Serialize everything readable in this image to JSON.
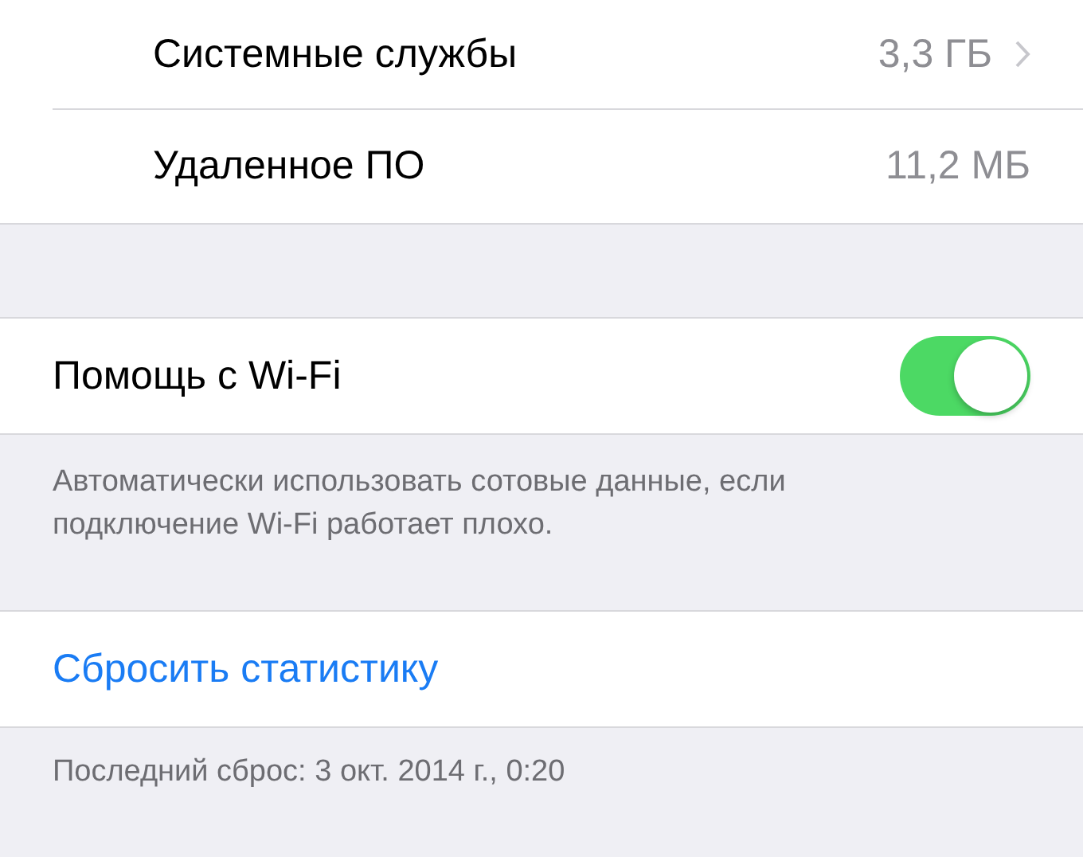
{
  "storage_rows": [
    {
      "label": "Системные службы",
      "value": "3,3 ГБ",
      "chevron": true
    },
    {
      "label": "Удаленное ПО",
      "value": "11,2 МБ",
      "chevron": false
    }
  ],
  "wifi_assist": {
    "label": "Помощь с Wi-Fi",
    "on": true,
    "footer": "Автоматически использовать сотовые данные, если подключение Wi-Fi работает плохо."
  },
  "reset": {
    "label": "Сбросить статистику",
    "footer": "Последний сброс: 3 окт. 2014 г., 0:20"
  }
}
